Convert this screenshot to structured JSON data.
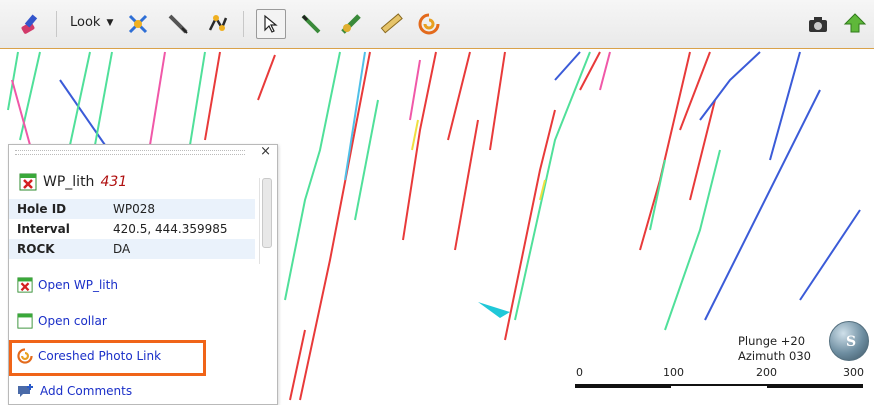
{
  "toolbar": {
    "look_label": "Look",
    "tools": [
      "eraser-pen-icon",
      "look-dropdown",
      "axes-icon",
      "slice-pen-icon",
      "polyline-icon",
      "select-arrow-icon",
      "drillhole-pen-icon",
      "interval-icon",
      "ruler-icon",
      "coreshed-icon",
      "camera-icon",
      "export-arrow-icon"
    ]
  },
  "panel": {
    "title": "WP_lith",
    "count": "431",
    "rows": [
      {
        "key": "Hole ID",
        "value": "WP028"
      },
      {
        "key": "Interval",
        "value": "420.5, 444.359985"
      },
      {
        "key": "ROCK",
        "value": "DA"
      }
    ],
    "links": {
      "open_table": "Open WP_lith",
      "open_collar": "Open collar",
      "coreshed": "Coreshed Photo Link",
      "add_comments": "Add Comments"
    },
    "close_glyph": "×"
  },
  "orientation": {
    "plunge": "Plunge +20",
    "azimuth": "Azimuth 030"
  },
  "scale_bar": {
    "labels": [
      "0",
      "100",
      "200",
      "300"
    ]
  },
  "colors": {
    "accent_highlight": "#f06418",
    "link": "#1a2fc8",
    "toolbar_border": "#d9a24a"
  }
}
